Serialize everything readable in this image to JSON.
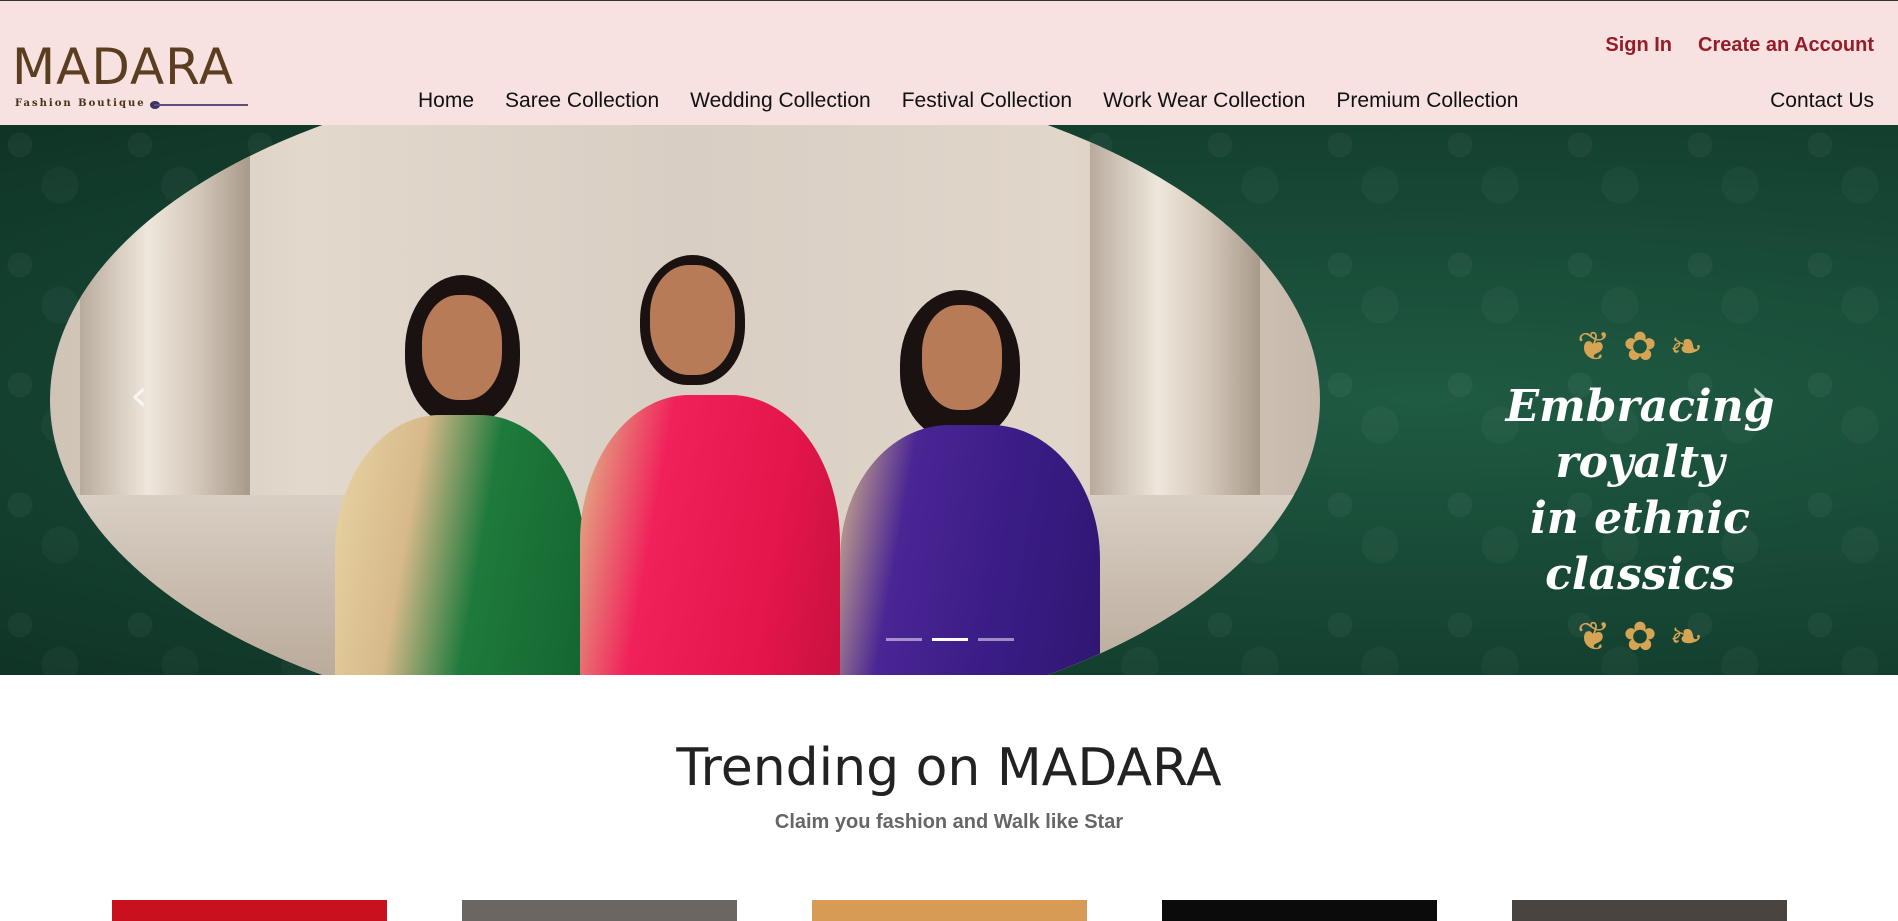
{
  "brand": {
    "name": "MADARA",
    "tagline": "Fashion Boutique",
    "color": "#5b3d1f"
  },
  "account": {
    "sign_in": "Sign In",
    "create_account": "Create an Account",
    "color": "#951d2a"
  },
  "nav": {
    "items": [
      {
        "label": "Home"
      },
      {
        "label": "Saree Collection"
      },
      {
        "label": "Wedding Collection"
      },
      {
        "label": "Festival Collection"
      },
      {
        "label": "Work Wear Collection"
      },
      {
        "label": "Premium Collection"
      }
    ],
    "contact": "Contact Us"
  },
  "hero": {
    "headline_line1": "Embracing royalty",
    "headline_line2": "in ethnic classics",
    "background": "#164634",
    "accent": "#d6a455",
    "prev_icon": "chevron-left-icon",
    "next_icon": "chevron-right-icon",
    "slides": 3,
    "active_slide": 2
  },
  "trending": {
    "title": "Trending on MADARA",
    "subtitle": "Claim you fashion and Walk like Star",
    "products": [
      {
        "color": "#c8101f"
      },
      {
        "color": "#6c6663"
      },
      {
        "color": "#d79b55"
      },
      {
        "color": "#0b0b0b"
      },
      {
        "color": "#4a4440"
      }
    ]
  },
  "header": {
    "background": "#f7e1e1"
  }
}
